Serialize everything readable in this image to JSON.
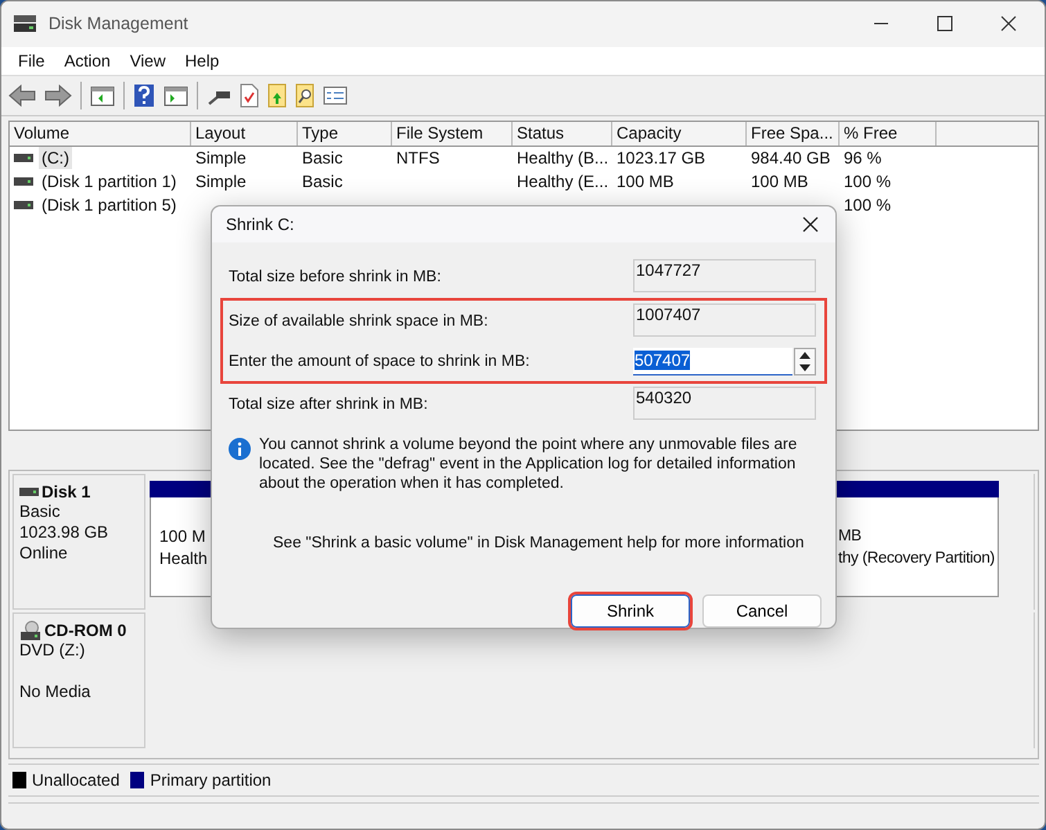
{
  "window": {
    "title": "Disk Management"
  },
  "menu": [
    "File",
    "Action",
    "View",
    "Help"
  ],
  "volumes": {
    "columns": [
      "Volume",
      "Layout",
      "Type",
      "File System",
      "Status",
      "Capacity",
      "Free Spa...",
      "% Free"
    ],
    "rows": [
      {
        "volume": "(C:)",
        "layout": "Simple",
        "type": "Basic",
        "file_system": "NTFS",
        "status": "Healthy (B...",
        "capacity": "1023.17 GB",
        "free_space": "984.40 GB",
        "pct_free": "96 %",
        "selected": true
      },
      {
        "volume": "(Disk 1 partition 1)",
        "layout": "Simple",
        "type": "Basic",
        "status": "Healthy (E...",
        "capacity": "100 MB",
        "free_space": "100 MB",
        "pct_free": "100 %",
        "selected": false
      },
      {
        "volume": "(Disk 1 partition 5)",
        "pct_free": "100 %",
        "selected": false
      }
    ]
  },
  "disks": [
    {
      "name": "Disk 1",
      "kind": "disk",
      "lines": [
        "Basic",
        "1023.98 GB",
        "Online"
      ],
      "partitions": [
        {
          "lines": [
            "100 M",
            "Health"
          ]
        },
        {
          "lines": [
            "MB",
            "thy (Recovery Partition)"
          ]
        }
      ]
    },
    {
      "name": "CD-ROM 0",
      "kind": "cdrom",
      "lines": [
        "DVD (Z:)",
        "No Media"
      ]
    }
  ],
  "legend": [
    {
      "label": "Unallocated",
      "color": "#000000"
    },
    {
      "label": "Primary partition",
      "color": "#000080"
    }
  ],
  "dialog": {
    "title": "Shrink C:",
    "fields": [
      {
        "label": "Total size before shrink in MB:",
        "value": "1047727",
        "kind": "readonly",
        "highlighted": false
      },
      {
        "label": "Size of available shrink space in MB:",
        "value": "1007407",
        "kind": "readonly",
        "highlighted": true
      },
      {
        "label": "Enter the amount of space to shrink in MB:",
        "value": "507407",
        "kind": "spin",
        "highlighted": true,
        "text_selected": true
      },
      {
        "label": "Total size after shrink in MB:",
        "value": "540320",
        "kind": "readonly",
        "highlighted": false
      }
    ],
    "info": "You cannot shrink a volume beyond the point where any unmovable files are located. See the \"defrag\" event in the Application log for detailed information about the operation when it has completed.",
    "help": "See \"Shrink a basic volume\" in Disk Management help for more information",
    "buttons": [
      {
        "label": "Shrink",
        "default": true,
        "highlighted": true
      },
      {
        "label": "Cancel",
        "default": false,
        "highlighted": false
      }
    ]
  }
}
